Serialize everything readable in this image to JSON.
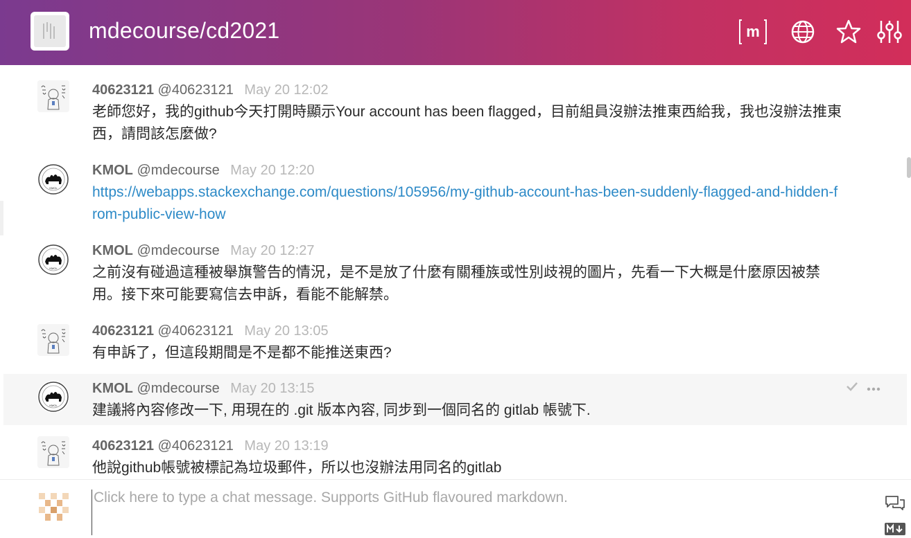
{
  "header": {
    "room_title": "mdecourse/cd2021",
    "matrix_label": "m",
    "colors": {
      "gradient_start": "#7b3a8f",
      "gradient_end": "#d22e5a"
    },
    "icons": [
      "matrix-icon",
      "globe-icon",
      "star-icon",
      "settings-sliders-icon"
    ]
  },
  "messages": [
    {
      "name": "40623121",
      "handle": "@40623121",
      "time": "May 20 12:02",
      "text": "老師您好，我的github今天打開時顯示Your account has been flagged，目前組員沒辦法推東西給我，我也沒辦法推東西，請問該怎麼做?"
    },
    {
      "name": "KMOL",
      "handle": "@mdecourse",
      "time": "May 20 12:20",
      "link": "https://webapps.stackexchange.com/questions/105956/my-github-account-has-been-suddenly-flagged-and-hidden-from-public-view-how"
    },
    {
      "name": "KMOL",
      "handle": "@mdecourse",
      "time": "May 20 12:27",
      "text": "之前沒有碰過這種被舉旗警告的情況，是不是放了什麼有關種族或性別歧視的圖片，先看一下大概是什麼原因被禁用。接下來可能要寫信去申訴，看能不能解禁。"
    },
    {
      "name": "40623121",
      "handle": "@40623121",
      "time": "May 20 13:05",
      "text": "有申訴了，但這段期間是不是都不能推送東西?"
    },
    {
      "name": "KMOL",
      "handle": "@mdecourse",
      "time": "May 20 13:15",
      "text": "建議將內容修改一下, 用現在的 .git 版本內容, 同步到一個同名的 gitlab 帳號下."
    },
    {
      "name": "40623121",
      "handle": "@40623121",
      "time": "May 20 13:19",
      "text": "他說github帳號被標記為垃圾郵件，所以也沒辦法用同名的gitlab"
    }
  ],
  "composer": {
    "placeholder": "Click here to type a chat message. Supports GitHub flavoured markdown.",
    "value": ""
  }
}
